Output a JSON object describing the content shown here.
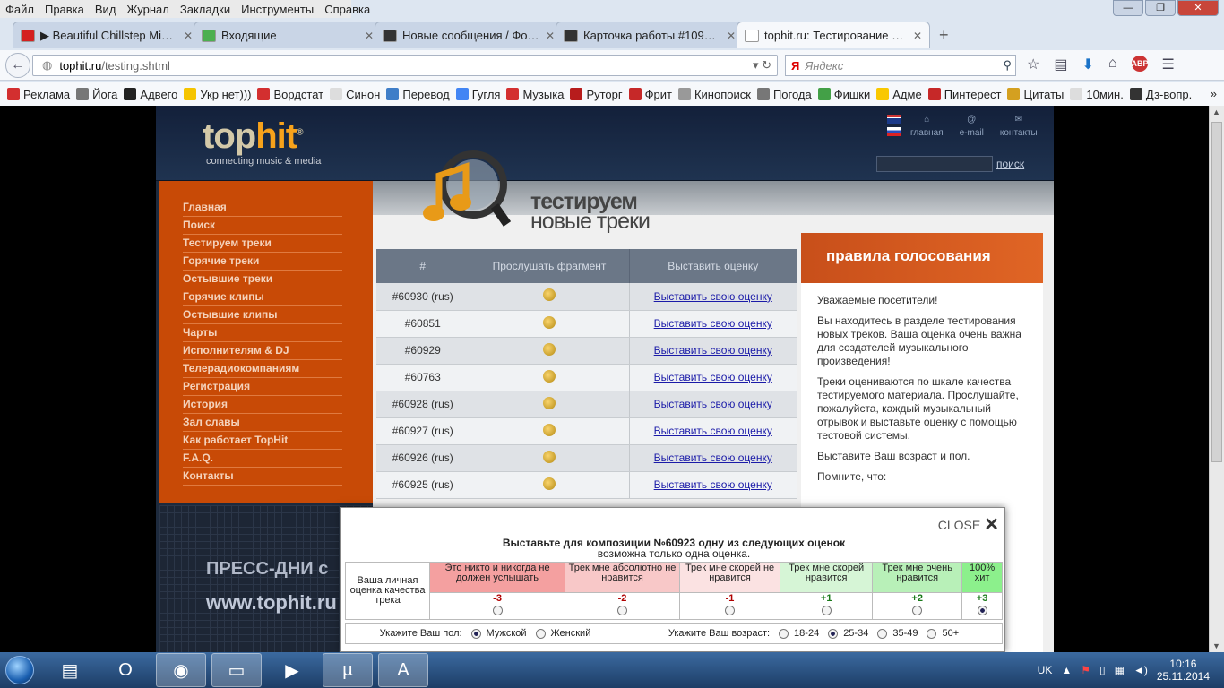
{
  "browser": {
    "menu": [
      "Файл",
      "Правка",
      "Вид",
      "Журнал",
      "Закладки",
      "Инструменты",
      "Справка"
    ],
    "tabs": [
      {
        "title": "▶ Beautiful Chillstep Mix #...",
        "color": "#d42020"
      },
      {
        "title": "Входящие",
        "color": "#4caf50"
      },
      {
        "title": "Новые сообщения / Фор...",
        "color": "#333333"
      },
      {
        "title": "Карточка работы #109747...",
        "color": "#333333"
      },
      {
        "title": "tophit.ru: Тестирование ново...",
        "color": "#ffffff"
      }
    ],
    "new_tab": "+",
    "url_host": "tophit.ru",
    "url_path": "/testing.shtml",
    "search_engine": "Я",
    "search_placeholder": "Яндекс",
    "bookmarks": [
      {
        "label": "Реклама",
        "color": "#d32f2f"
      },
      {
        "label": "Йога",
        "color": "#777777"
      },
      {
        "label": "Адвего",
        "color": "#222222"
      },
      {
        "label": "Укр нет)))",
        "color": "#f5c400"
      },
      {
        "label": "Вордстат",
        "color": "#d32f2f"
      },
      {
        "label": "Синон",
        "color": "#dddddd"
      },
      {
        "label": "Перевод",
        "color": "#3f7ec8"
      },
      {
        "label": "Гугля",
        "color": "#4285f4"
      },
      {
        "label": "Музыка",
        "color": "#d32f2f"
      },
      {
        "label": "Руторг",
        "color": "#b71c1c"
      },
      {
        "label": "Фрит",
        "color": "#c62828"
      },
      {
        "label": "Кинопоиск",
        "color": "#999999"
      },
      {
        "label": "Погода",
        "color": "#777777"
      },
      {
        "label": "Фишки",
        "color": "#43a047"
      },
      {
        "label": "Адме",
        "color": "#f9c800"
      },
      {
        "label": "Пинтерест",
        "color": "#c62828"
      },
      {
        "label": "Цитаты",
        "color": "#d4a020"
      },
      {
        "label": "10мин.",
        "color": "#dddddd"
      },
      {
        "label": "Дз-вопр.",
        "color": "#333333"
      }
    ],
    "bookmarks_more": "»"
  },
  "site": {
    "logo_a": "top",
    "logo_b": "hit",
    "logo_reg": "®",
    "slogan": "connecting music & media",
    "topnav": [
      {
        "label": "главная",
        "icon": "home-icon",
        "glyph": "⌂"
      },
      {
        "label": "e-mail",
        "icon": "at-icon",
        "glyph": "@"
      },
      {
        "label": "контакты",
        "icon": "envelope-icon",
        "glyph": "✉"
      }
    ],
    "search_button": "поиск",
    "sidebar": [
      "Главная",
      "Поиск",
      "Тестируем треки",
      "Горячие треки",
      "Остывшие треки",
      "Горячие клипы",
      "Остывшие клипы",
      "Чарты",
      "Исполнителям & DJ",
      "Телерадиокомпаниям",
      "Регистрация",
      "История",
      "Зал славы",
      "Как работает TopHit",
      "F.A.Q.",
      "Контакты"
    ],
    "banner_line1": "ПРЕСС-ДНИ с",
    "banner_line2": "www.tophit.ru",
    "page_title_line1": "тестируем",
    "page_title_line2": "новые треки",
    "table_headers": [
      "#",
      "Прослушать фрагмент",
      "Выставить оценку"
    ],
    "tracks": [
      {
        "id": "#60930 (rus)",
        "action": "Выставить свою оценку"
      },
      {
        "id": "#60851",
        "action": "Выставить свою оценку"
      },
      {
        "id": "#60929",
        "action": "Выставить свою оценку"
      },
      {
        "id": "#60763",
        "action": "Выставить свою оценку"
      },
      {
        "id": "#60928 (rus)",
        "action": "Выставить свою оценку"
      },
      {
        "id": "#60927 (rus)",
        "action": "Выставить свою оценку"
      },
      {
        "id": "#60926 (rus)",
        "action": "Выставить свою оценку"
      },
      {
        "id": "#60925 (rus)",
        "action": "Выставить свою оценку"
      }
    ],
    "rules_title": "правила голосования",
    "rules_p1": "Уважаемые посетители!",
    "rules_p2": "Вы находитесь в разделе тестирования новых треков. Ваша оценка очень важна для создателей музыкального произведения!",
    "rules_p3": "Треки оцениваются по шкале качества тестируемого материала. Прослушайте, пожалуйста, каждый музыкальный отрывок и выставьте оценку с помощью тестовой системы.",
    "rules_p4": "Выставите Ваш возраст и пол.",
    "rules_p5": "Помните, что:"
  },
  "modal": {
    "close": "CLOSE",
    "title": "Выставьте для композиции №60923 одну из следующих оценок",
    "subtitle": "возможна только одна оценка.",
    "row_label": "Ваша личная оценка качества трека",
    "options": [
      {
        "label": "Это никто и никогда не должен услышать",
        "value": "-3",
        "bg": "#f4a0a0",
        "vcolor": "#b00000",
        "checked": false
      },
      {
        "label": "Трек мне абсолютно не нравится",
        "value": "-2",
        "bg": "#f8c8c8",
        "vcolor": "#b00000",
        "checked": false
      },
      {
        "label": "Трек мне скорей не нравится",
        "value": "-1",
        "bg": "#fbe2e2",
        "vcolor": "#b00000",
        "checked": false
      },
      {
        "label": "Трек мне скорей нравится",
        "value": "+1",
        "bg": "#d6f5d6",
        "vcolor": "#1a7a1a",
        "checked": false
      },
      {
        "label": "Трек мне очень нравится",
        "value": "+2",
        "bg": "#b8f0b8",
        "vcolor": "#1a7a1a",
        "checked": false
      },
      {
        "label": "100% хит",
        "value": "+3",
        "bg": "#8cf08c",
        "vcolor": "#1a7a1a",
        "checked": true
      }
    ],
    "gender_label": "Укажите Ваш пол:",
    "gender_options": [
      {
        "label": "Мужской",
        "checked": true
      },
      {
        "label": "Женский",
        "checked": false
      }
    ],
    "age_label": "Укажите Ваш возраст:",
    "age_options": [
      {
        "label": "18-24",
        "checked": false
      },
      {
        "label": "25-34",
        "checked": true
      },
      {
        "label": "35-49",
        "checked": false
      },
      {
        "label": "50+",
        "checked": false
      }
    ]
  },
  "taskbar": {
    "apps": [
      {
        "name": "taskbar-explorer-icon",
        "glyph": "▤",
        "active": false
      },
      {
        "name": "taskbar-opera-icon",
        "glyph": "O",
        "active": false
      },
      {
        "name": "taskbar-firefox-icon",
        "glyph": "◉",
        "active": true
      },
      {
        "name": "taskbar-folder-icon",
        "glyph": "▭",
        "active": true
      },
      {
        "name": "taskbar-media-icon",
        "glyph": "▶",
        "active": false
      },
      {
        "name": "taskbar-utorrent-icon",
        "glyph": "µ",
        "active": true
      },
      {
        "name": "taskbar-advego-icon",
        "glyph": "A",
        "active": true
      }
    ],
    "lang": "UK",
    "time": "10:16",
    "date": "25.11.2014"
  }
}
